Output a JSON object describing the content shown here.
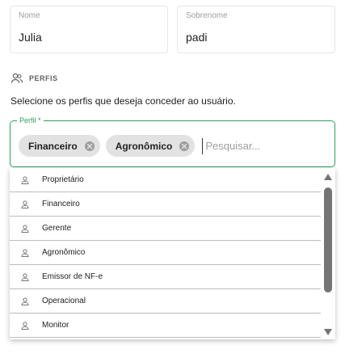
{
  "nome": {
    "label": "Nome",
    "value": "Julia"
  },
  "sobrenome": {
    "label": "Sobrenome",
    "value": "padi"
  },
  "section": {
    "title": "PERFIS",
    "icon": "users-icon"
  },
  "hint": "Selecione os perfis que deseja conceder ao usuário.",
  "perfil": {
    "label": "Perfil *",
    "accent_color": "#2e9e5b",
    "chips": [
      "Financeiro",
      "Agronômico"
    ],
    "search_placeholder": "Pesquisar..."
  },
  "options": [
    "Proprietário",
    "Financeiro",
    "Gerente",
    "Agronômico",
    "Emissor de NF-e",
    "Operacional",
    "Monitor"
  ]
}
